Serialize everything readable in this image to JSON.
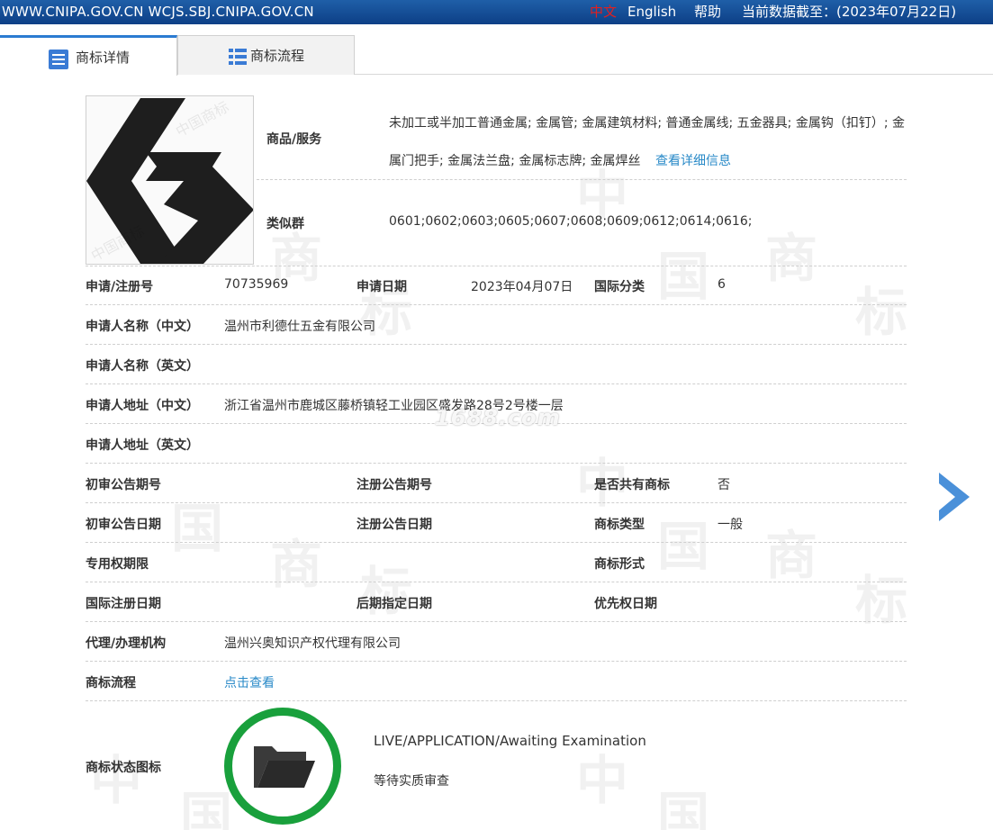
{
  "topbar": {
    "domains": "WWW.CNIPA.GOV.CN WCJS.SBJ.CNIPA.GOV.CN",
    "lang_cn": "中文",
    "lang_en": "English",
    "help": "帮助",
    "data_as_of": "当前数据截至：(2023年07月22日)"
  },
  "tabs": [
    {
      "label": "商标详情",
      "icon": "document-list-icon",
      "active": true
    },
    {
      "label": "商标流程",
      "icon": "list-icon",
      "active": false
    }
  ],
  "detail": {
    "goods_label": "商品/服务",
    "goods_value": "未加工或半加工普通金属; 金属管; 金属建筑材料; 普通金属线; 五金器具; 金属钩（扣钉）; 金属门把手; 金属法兰盘; 金属标志牌; 金属焊丝",
    "goods_more": "查看详细信息",
    "similar_label": "类似群",
    "similar_value": "0601;0602;0603;0605;0607;0608;0609;0612;0614;0616;",
    "regno_label": "申请/注册号",
    "regno_value": "70735969",
    "appdate_label": "申请日期",
    "appdate_value": "2023年04月07日",
    "intl_class_label": "国际分类",
    "intl_class_value": "6",
    "applicant_cn_label": "申请人名称（中文）",
    "applicant_cn_value": "温州市利德仕五金有限公司",
    "applicant_en_label": "申请人名称（英文）",
    "address_cn_label": "申请人地址（中文）",
    "address_cn_value": "浙江省温州市鹿城区藤桥镇轻工业园区盛发路28号2号楼一层",
    "address_en_label": "申请人地址（英文）",
    "prelim_no_label": "初审公告期号",
    "reg_no_label": "注册公告期号",
    "shared_label": "是否共有商标",
    "shared_value": "否",
    "prelim_date_label": "初审公告日期",
    "reg_date_label": "注册公告日期",
    "type_label": "商标类型",
    "type_value": "一般",
    "term_label": "专用权期限",
    "form_label": "商标形式",
    "intl_reg_label": "国际注册日期",
    "later_label": "后期指定日期",
    "priority_label": "优先权日期",
    "agent_label": "代理/办理机构",
    "agent_value": "温州兴奥知识产权代理有限公司",
    "flow_label": "商标流程",
    "flow_link": "点击查看",
    "status_icon_label": "商标状态图标",
    "status_en": "LIVE/APPLICATION/Awaiting Examination",
    "status_cn": "等待实质审查"
  },
  "overlay": "1688.com",
  "colors": {
    "topbar": "#164f99",
    "accent": "#2b7bd1",
    "link": "#2a8ac8",
    "status_ring": "#19a03c"
  }
}
